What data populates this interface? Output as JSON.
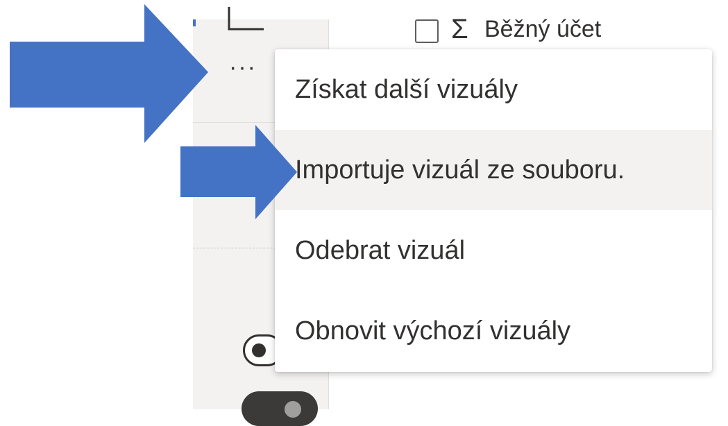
{
  "field_list": {
    "field": {
      "sigma": "Σ",
      "label": "Běžný účet"
    }
  },
  "visual_pane": {
    "more_options": "···"
  },
  "context_menu": {
    "items": [
      {
        "label": "Získat další vizuály"
      },
      {
        "label": "Importuje vizuál ze souboru.",
        "highlighted": true
      },
      {
        "label": "Odebrat vizuál"
      },
      {
        "label": "Obnovit výchozí vizuály"
      }
    ]
  },
  "colors": {
    "annotation_arrow": "#4472c4",
    "menu_highlight": "#f3f2f1",
    "pane_background": "#f3f2f1",
    "text": "#323130"
  },
  "annotations": [
    {
      "type": "arrow",
      "icon": "right-arrow",
      "points_to": "more-options-button"
    },
    {
      "type": "arrow",
      "icon": "right-arrow",
      "points_to": "menu-item-import-visual"
    }
  ]
}
